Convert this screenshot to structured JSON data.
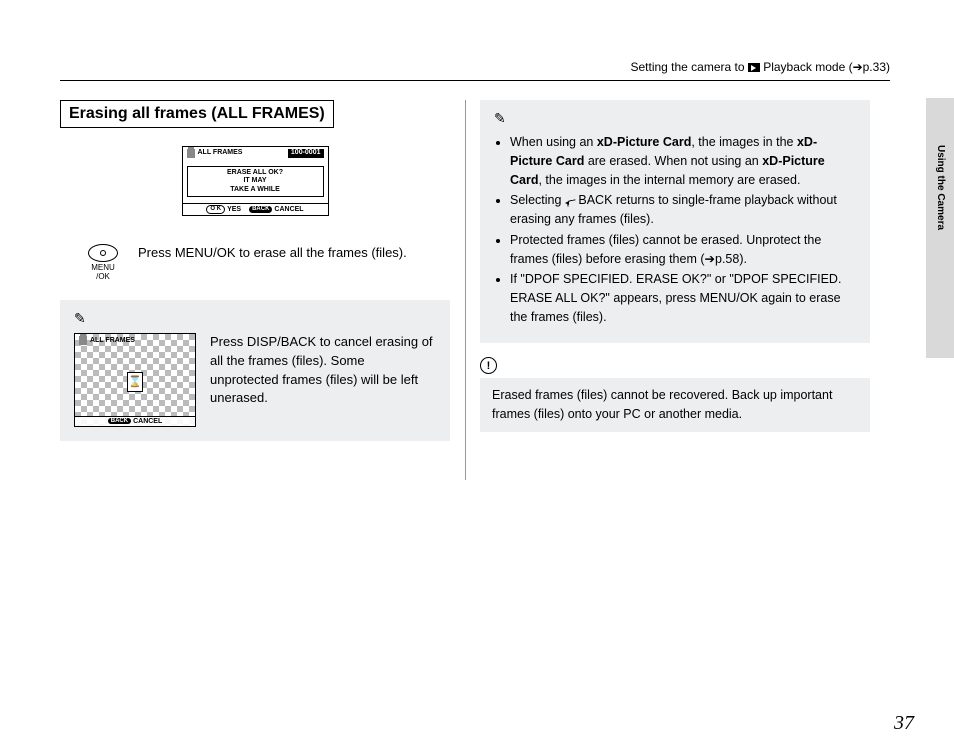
{
  "header": {
    "breadcrumb_prefix": "Setting the camera to ",
    "breadcrumb_suffix": " Playback mode (➔p.33)"
  },
  "side_tab": "Using the Camera",
  "page_number": "37",
  "left": {
    "title": "Erasing all frames (ALL FRAMES)",
    "lcd1": {
      "label": "ALL FRAMES",
      "counter": "100-0001",
      "msg_l1": "ERASE ALL OK?",
      "msg_l2": "IT  MAY",
      "msg_l3": "TAKE  A  WHILE",
      "ok_btn": "O K",
      "yes": "YES",
      "back_btn": "BACK",
      "cancel": "CANCEL"
    },
    "step": {
      "btn_l1": "MENU",
      "btn_l2": "/OK",
      "text": "Press MENU/OK to erase all the frames (files)."
    },
    "note1": {
      "lcd_label": "ALL FRAMES",
      "back_btn": "BACK",
      "cancel": "CANCEL",
      "text": "Press DISP/BACK to cancel erasing of all the frames (files). Some unprotected frames (files) will be left unerased."
    }
  },
  "right": {
    "bullets": [
      {
        "pre": "When using an ",
        "b1": "xD-Picture Card",
        "mid": ", the images in the ",
        "b2": "xD-Picture Card",
        "mid2": " are erased. When not using an ",
        "b3": "xD-Picture Card",
        "post": ", the images in the internal memory are erased."
      },
      {
        "plain_pre": "Selecting ",
        "plain_post": " BACK returns to single-frame playback without erasing any frames (files)."
      },
      {
        "plain": "Protected frames (files) cannot be erased. Unprotect the frames (files) before erasing them (➔p.58)."
      },
      {
        "plain": "If \"DPOF SPECIFIED. ERASE OK?\" or \"DPOF SPECIFIED. ERASE ALL OK?\" appears, press MENU/OK again to erase the frames (files)."
      }
    ],
    "caution_mark": "!",
    "caution": "Erased frames (files) cannot be recovered. Back up important frames (files) onto your PC or another media."
  }
}
